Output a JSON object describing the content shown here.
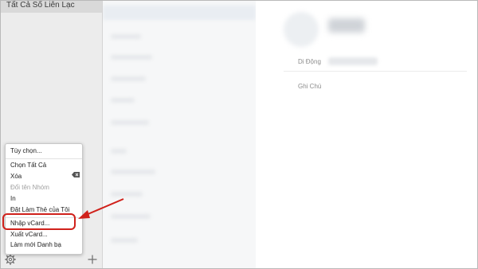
{
  "sidebar": {
    "header": "Tất Cả Số Liên Lạc"
  },
  "detail": {
    "fields": [
      {
        "label": "Di Động"
      },
      {
        "label": "Ghi Chú"
      }
    ]
  },
  "menu": {
    "items": [
      {
        "label": "Tùy chọn...",
        "enabled": true
      },
      {
        "label": "Chọn Tất Cả",
        "enabled": true
      },
      {
        "label": "Xóa",
        "enabled": true
      },
      {
        "label": "Đổi tên Nhóm",
        "enabled": false
      },
      {
        "label": "In",
        "enabled": true
      },
      {
        "label": "Đặt Làm Thẻ của Tôi",
        "enabled": true
      },
      {
        "label": "Nhập vCard...",
        "enabled": true,
        "highlighted": true
      },
      {
        "label": "Xuất vCard...",
        "enabled": true
      },
      {
        "label": "Làm mới Danh bạ",
        "enabled": true
      }
    ]
  },
  "icons": {
    "settings": "gear-icon",
    "add": "plus-icon",
    "delete": "delete-backspace-icon"
  },
  "colors": {
    "annotation": "#d0211b"
  }
}
